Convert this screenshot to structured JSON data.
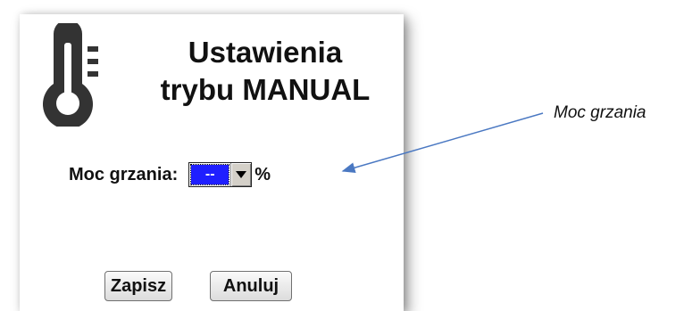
{
  "dialog": {
    "title_line1": "Ustawienia",
    "title_line2": "trybu MANUAL",
    "icon": "thermometer-icon",
    "power_label": "Moc grzania:",
    "power_select_value": "--",
    "power_unit": "%",
    "save_label": "Zapisz",
    "cancel_label": "Anuluj"
  },
  "annotation": {
    "text": "Moc grzania",
    "arrow_color": "#4a78c2"
  },
  "colors": {
    "select_highlight": "#1f1fff",
    "icon": "#333333"
  }
}
